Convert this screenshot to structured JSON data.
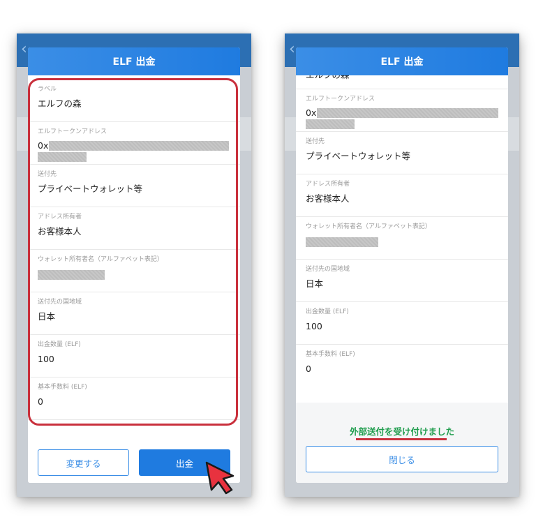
{
  "left_screen": {
    "dialog_title": "ELF 出金",
    "fields": [
      {
        "label": "ラベル",
        "value": "エルフの森"
      },
      {
        "label": "エルフトークンアドレス",
        "value": "0x"
      },
      {
        "label": "送付先",
        "value": "プライベートウォレット等"
      },
      {
        "label": "アドレス所有者",
        "value": "お客様本人"
      },
      {
        "label": "ウォレット所有者名（アルファベット表記）",
        "value": ""
      },
      {
        "label": "送付先の国地域",
        "value": "日本"
      },
      {
        "label": "出金数量 (ELF)",
        "value": "100"
      },
      {
        "label": "基本手数料 (ELF)",
        "value": "0"
      }
    ],
    "change_button": "変更する",
    "withdraw_button": "出金"
  },
  "right_screen": {
    "dialog_title": "ELF 出金",
    "partial_first_value": "エルフの森",
    "fields": [
      {
        "label": "エルフトークンアドレス",
        "value": "0x"
      },
      {
        "label": "送付先",
        "value": "プライベートウォレット等"
      },
      {
        "label": "アドレス所有者",
        "value": "お客様本人"
      },
      {
        "label": "ウォレット所有者名（アルファベット表記）",
        "value": ""
      },
      {
        "label": "送付先の国地域",
        "value": "日本"
      },
      {
        "label": "出金数量 (ELF)",
        "value": "100"
      },
      {
        "label": "基本手数料 (ELF)",
        "value": "0"
      }
    ],
    "success_message": "外部送付を受け付けました",
    "close_button": "閉じる"
  },
  "colors": {
    "header_blue": "#1f7be0",
    "primary_button": "#1f7be0",
    "highlight_red": "#c9303c",
    "success_green": "#1f9d4d"
  },
  "icons": {
    "back": "chevron-left-icon",
    "cursor": "mouse-pointer-arrow-icon"
  }
}
